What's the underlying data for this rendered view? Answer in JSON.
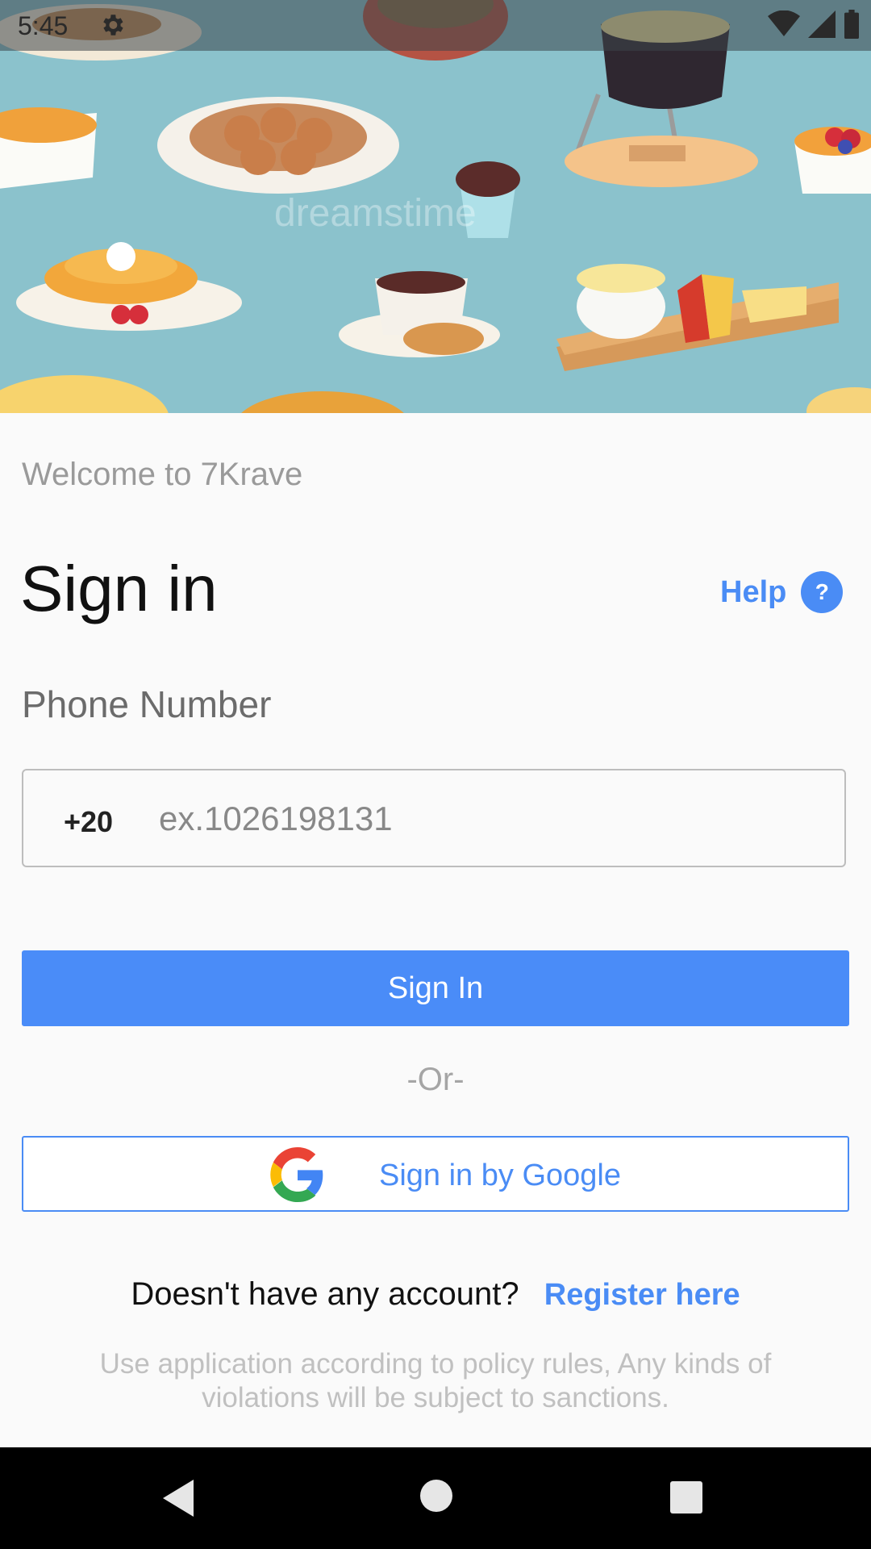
{
  "status_bar": {
    "time": "5:45",
    "icons": [
      "gear-icon",
      "wifi-icon",
      "signal-icon",
      "battery-icon"
    ]
  },
  "hero": {
    "watermark": "dreamstime"
  },
  "header": {
    "welcome": "Welcome to 7Krave",
    "title": "Sign in",
    "help_label": "Help",
    "help_icon_glyph": "?"
  },
  "form": {
    "phone_label": "Phone Number",
    "country_code": "+20",
    "phone_placeholder": "ex.1026198131",
    "phone_value": ""
  },
  "actions": {
    "signin_label": "Sign In",
    "or_separator": "-Or-",
    "google_label": "Sign in by Google"
  },
  "footer": {
    "no_account": "Doesn't have any account?",
    "register_link": "Register here",
    "policy": "Use application according to policy rules, Any kinds of violations will be subject to sanctions."
  },
  "nav_bar": {
    "buttons": [
      "back-icon",
      "home-icon",
      "recents-icon"
    ]
  },
  "colors": {
    "accent": "#4a8cf8",
    "hero_bg": "#8bc2cc",
    "background": "#fafafa",
    "muted_text": "#9a9a9a"
  }
}
